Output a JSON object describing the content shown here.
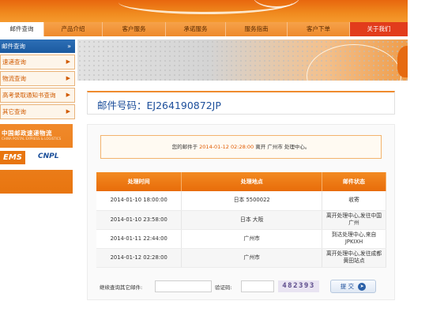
{
  "nav": {
    "items": [
      {
        "label": "邮件查询"
      },
      {
        "label": "产品介绍"
      },
      {
        "label": "客户服务"
      },
      {
        "label": "承诺服务"
      },
      {
        "label": "服务指南"
      },
      {
        "label": "客户下单"
      },
      {
        "label": "关于我们"
      }
    ]
  },
  "sidebar": {
    "header": "邮件查询",
    "header_icon": "double-chevron-up-icon",
    "items": [
      {
        "label": "速递查询"
      },
      {
        "label": "物流查询"
      },
      {
        "label": "高考录取通知书查询"
      },
      {
        "label": "其它查询"
      }
    ],
    "promo": {
      "line1": "中国邮政速递物流",
      "line2": "CHINA POSTAL EXPRESS & LOGISTICS",
      "ems": "EMS",
      "cnpl": "CNPL"
    }
  },
  "tracking": {
    "title": "邮件号码：EJ264190872JP"
  },
  "status": {
    "prefix": "您的邮件于",
    "time": "2014-01-12 02:28:00",
    "text": "离开 广州市 处理中心。"
  },
  "table": {
    "headers": [
      "处理时间",
      "处理地点",
      "邮件状态"
    ],
    "rows": [
      {
        "time": "2014-01-10 18:00:00",
        "place": "日本 5500022",
        "state": "收寄"
      },
      {
        "time": "2014-01-10 23:58:00",
        "place": "日本 大阪",
        "state": "离开处理中心,发往中国 广州"
      },
      {
        "time": "2014-01-11 22:44:00",
        "place": "广州市",
        "state": "到达处理中心,来自JPKIXH"
      },
      {
        "time": "2014-01-12 02:28:00",
        "place": "广州市",
        "state": "离开处理中心,发往成都黄田站点"
      }
    ]
  },
  "form": {
    "label_query": "继续查询其它邮件:",
    "label_captcha": "验证码:",
    "captcha_text": "482393",
    "submit_label": "提 交"
  },
  "colors": {
    "accent": "#ef8b2e",
    "brand_blue": "#1d4f9b"
  }
}
